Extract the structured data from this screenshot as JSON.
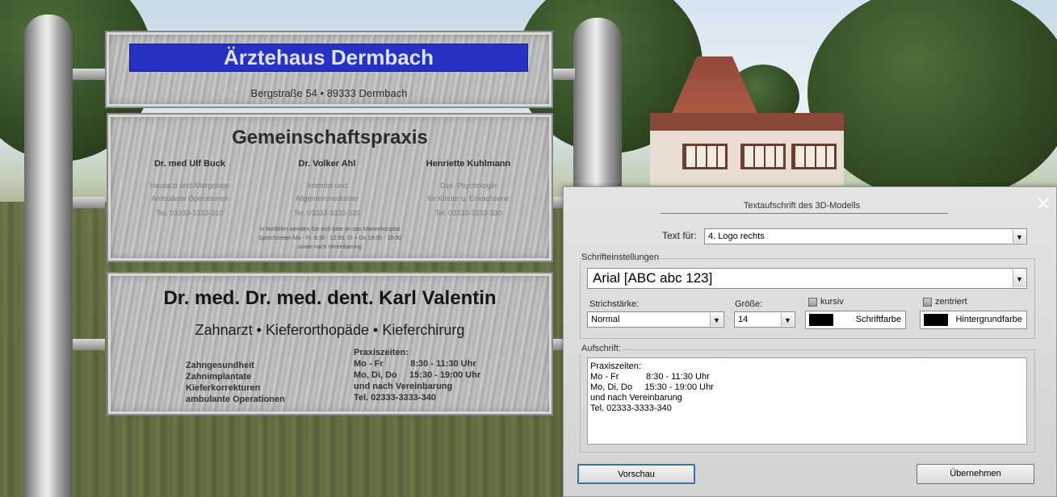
{
  "sign": {
    "header_title": "Ärztehaus Dermbach",
    "address": "Bergstraße 54 • 89333 Dermbach",
    "practice_title": "Gemeinschaftspraxis",
    "doctors": [
      {
        "name": "Dr. med Ulf Buck",
        "line1": "Hautarzt und Allergologe",
        "line2": "Ambulante Operationen",
        "phone": "Tel. 03333-3333-310"
      },
      {
        "name": "Dr. Volker Ahl",
        "line1": "Internist und",
        "line2": "Allgemeinmediziner",
        "phone": "Tel. 03333-3333-320"
      },
      {
        "name": "Henriette Kuhlmann",
        "line1": "Dipl.-Psychologin",
        "line2": "für Kinder u. Erwachsene",
        "phone": "Tel. 03333-3333-330"
      }
    ],
    "notice1": "In Notfällen wenden Sie sich bitte an das Marienhospital",
    "notice2": "Sprechzeiten Mo - Fr. 8:30 - 12:00, Di + Do 15:00 - 18:00",
    "notice3": "sowie nach Vereinbarung",
    "dentist_name": "Dr. med. Dr. med. dent. Karl Valentin",
    "dentist_specialty": "Zahnarzt • Kieferorthopäde • Kieferchirurg",
    "services": "Zahngesundheit\nZahnimplantate\nKieferkorrekturen\nambulante Operationen",
    "hours": "Praxiszeiten:\nMo - Fr           8:30 - 11:30 Uhr\nMo, Di, Do     15:30 - 19:00 Uhr\nund nach Vereinbarung\nTel. 02333-3333-340"
  },
  "dialog": {
    "title": "Textaufschrift des 3D-Modells",
    "close_glyph": "✕",
    "text_for_label": "Text für:",
    "text_for_value": "4. Logo rechts",
    "font_group_label": "Schrifteinstellungen",
    "font_value": "Arial  [ABC abc 123]",
    "stroke_label": "Strichstärke:",
    "stroke_value": "Normal",
    "size_label": "Größe:",
    "size_value": "14",
    "italic_label": "kursiv",
    "centered_label": "zentriert",
    "font_color_label": "Schriftfarbe",
    "bg_color_label": "Hintergrundfarbe",
    "font_color": "#000000",
    "bg_color": "#000000",
    "inscription_label": "Aufschrift:",
    "inscription_text": "Praxiszeiten:\nMo - Fr           8:30 - 11:30 Uhr\nMo, Di, Do     15:30 - 19:00 Uhr\nund nach Vereinbarung\nTel. 02333-3333-340",
    "preview_button": "Vorschau",
    "apply_button": "Übernehmen",
    "dropdown_glyph": "▼"
  }
}
